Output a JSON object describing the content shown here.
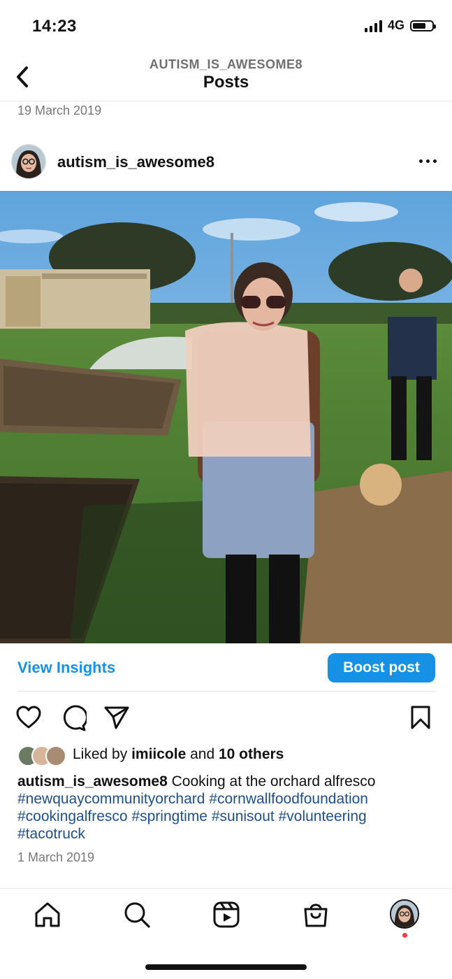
{
  "status_bar": {
    "time": "14:23",
    "network": "4G"
  },
  "header": {
    "username": "AUTISM_IS_AWESOME8",
    "title": "Posts"
  },
  "top_date": "19 March 2019",
  "post": {
    "username": "autism_is_awesome8",
    "actions": {
      "view_insights": "View Insights",
      "boost_post": "Boost post"
    },
    "likes": {
      "prefix": "Liked by ",
      "user": "imiicole",
      "middle": " and ",
      "others": "10 others"
    },
    "caption": {
      "username": "autism_is_awesome8",
      "text": " Cooking at the orchard alfresco",
      "hashtags": [
        "#newquaycommunityorchard",
        "#cornwallfoodfoundation",
        "#cookingalfresco",
        "#springtime",
        "#sunisout",
        "#volunteering",
        "#tacotruck"
      ]
    },
    "date": "1 March 2019"
  },
  "icons": {
    "back": "chevron-left-icon",
    "more": "more-horizontal-icon",
    "like": "heart-icon",
    "comment": "comment-icon",
    "share": "send-icon",
    "save": "bookmark-icon",
    "nav": [
      "home-icon",
      "search-icon",
      "reels-icon",
      "shop-icon",
      "profile-avatar"
    ]
  },
  "colors": {
    "accent": "#1592e6",
    "hashtag": "#1f4f8a",
    "notification": "#ef3b4e"
  }
}
